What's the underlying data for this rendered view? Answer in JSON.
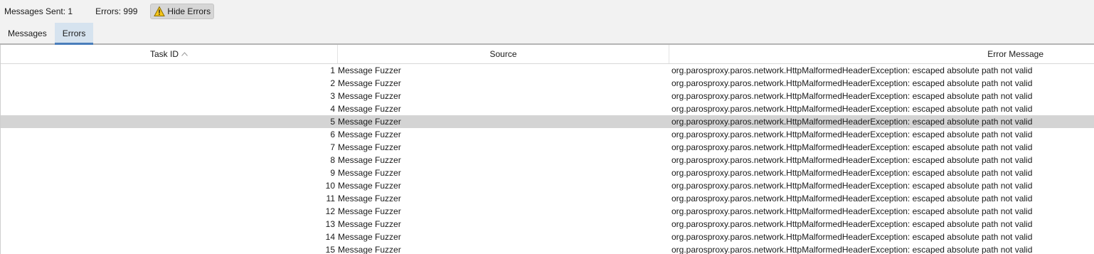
{
  "toolbar": {
    "messages_sent": "Messages Sent: 1",
    "errors": "Errors: 999",
    "hide_errors_label": "Hide Errors",
    "hide_errors_icon": "warning-icon"
  },
  "tabs": [
    {
      "label": "Messages",
      "active": false
    },
    {
      "label": "Errors",
      "active": true
    }
  ],
  "table": {
    "columns": [
      "Task ID",
      "Source",
      "Error Message"
    ],
    "sort_column": "Task ID",
    "sort_direction": "ascending",
    "selected_row": 5,
    "rows": [
      {
        "id": "1",
        "source": "Message Fuzzer",
        "error": "org.parosproxy.paros.network.HttpMalformedHeaderException: escaped absolute path not valid"
      },
      {
        "id": "2",
        "source": "Message Fuzzer",
        "error": "org.parosproxy.paros.network.HttpMalformedHeaderException: escaped absolute path not valid"
      },
      {
        "id": "3",
        "source": "Message Fuzzer",
        "error": "org.parosproxy.paros.network.HttpMalformedHeaderException: escaped absolute path not valid"
      },
      {
        "id": "4",
        "source": "Message Fuzzer",
        "error": "org.parosproxy.paros.network.HttpMalformedHeaderException: escaped absolute path not valid"
      },
      {
        "id": "5",
        "source": "Message Fuzzer",
        "error": "org.parosproxy.paros.network.HttpMalformedHeaderException: escaped absolute path not valid"
      },
      {
        "id": "6",
        "source": "Message Fuzzer",
        "error": "org.parosproxy.paros.network.HttpMalformedHeaderException: escaped absolute path not valid"
      },
      {
        "id": "7",
        "source": "Message Fuzzer",
        "error": "org.parosproxy.paros.network.HttpMalformedHeaderException: escaped absolute path not valid"
      },
      {
        "id": "8",
        "source": "Message Fuzzer",
        "error": "org.parosproxy.paros.network.HttpMalformedHeaderException: escaped absolute path not valid"
      },
      {
        "id": "9",
        "source": "Message Fuzzer",
        "error": "org.parosproxy.paros.network.HttpMalformedHeaderException: escaped absolute path not valid"
      },
      {
        "id": "10",
        "source": "Message Fuzzer",
        "error": "org.parosproxy.paros.network.HttpMalformedHeaderException: escaped absolute path not valid"
      },
      {
        "id": "11",
        "source": "Message Fuzzer",
        "error": "org.parosproxy.paros.network.HttpMalformedHeaderException: escaped absolute path not valid"
      },
      {
        "id": "12",
        "source": "Message Fuzzer",
        "error": "org.parosproxy.paros.network.HttpMalformedHeaderException: escaped absolute path not valid"
      },
      {
        "id": "13",
        "source": "Message Fuzzer",
        "error": "org.parosproxy.paros.network.HttpMalformedHeaderException: escaped absolute path not valid"
      },
      {
        "id": "14",
        "source": "Message Fuzzer",
        "error": "org.parosproxy.paros.network.HttpMalformedHeaderException: escaped absolute path not valid"
      },
      {
        "id": "15",
        "source": "Message Fuzzer",
        "error": "org.parosproxy.paros.network.HttpMalformedHeaderException: escaped absolute path not valid"
      }
    ]
  },
  "colors": {
    "selected_row": "#d4d4d4",
    "active_tab": "#d6e3ef",
    "active_tab_underline": "#4a7ebb",
    "warning_icon": "#f5c518"
  }
}
